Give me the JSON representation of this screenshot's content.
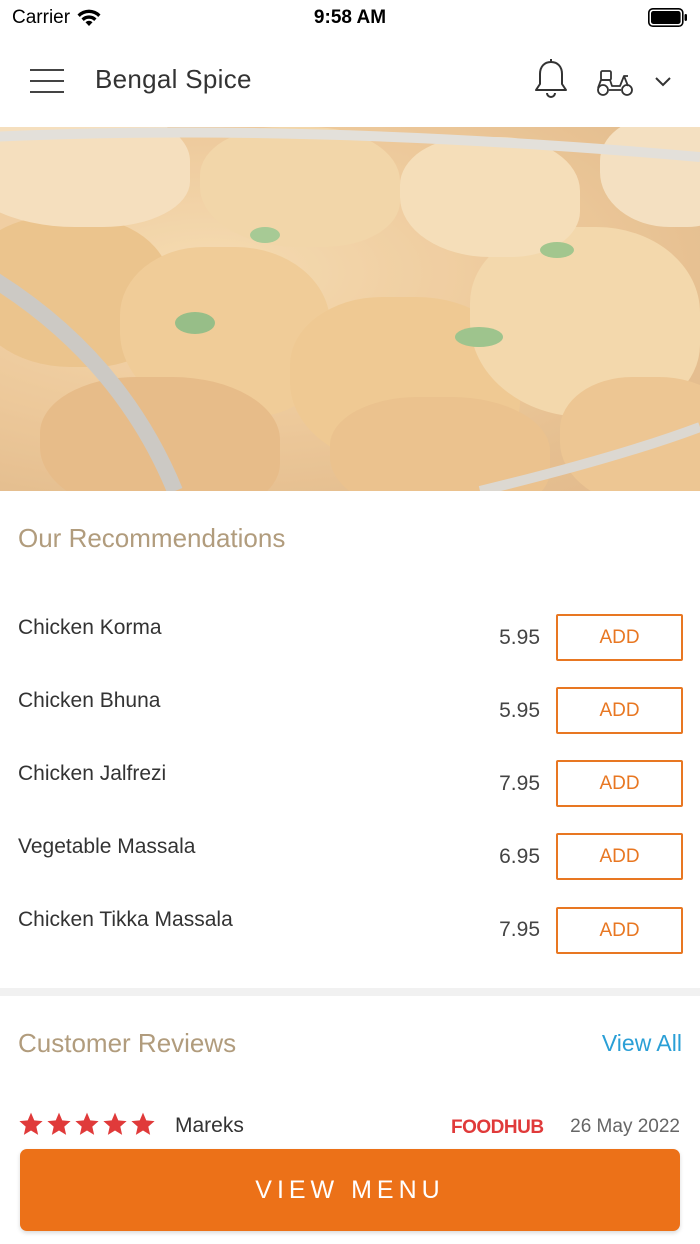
{
  "status_bar": {
    "carrier": "Carrier",
    "time": "9:58 AM"
  },
  "header": {
    "restaurant_name": "Bengal Spice",
    "menu_icon": "hamburger-menu-icon",
    "notification_icon": "bell-icon",
    "order_mode_icon": "scooter-delivery-icon",
    "dropdown_icon": "chevron-down-icon"
  },
  "hero": {
    "image_subject": "chicken curry dish"
  },
  "recommendations": {
    "title": "Our Recommendations",
    "items": [
      {
        "name": "Chicken Korma",
        "price": "5.95",
        "button": "ADD"
      },
      {
        "name": "Chicken Bhuna",
        "price": "5.95",
        "button": "ADD"
      },
      {
        "name": "Chicken Jalfrezi",
        "price": "7.95",
        "button": "ADD"
      },
      {
        "name": "Vegetable Massala",
        "price": "6.95",
        "button": "ADD"
      },
      {
        "name": "Chicken Tikka Massala",
        "price": "7.95",
        "button": "ADD"
      }
    ]
  },
  "reviews": {
    "title": "Customer Reviews",
    "view_all": "View All",
    "items": [
      {
        "rating": 5,
        "reviewer": "Mareks",
        "source": "FOODHUB",
        "date": "26 May 2022"
      }
    ]
  },
  "cta": {
    "label": "VIEW MENU"
  },
  "colors": {
    "accent": "#ec7118",
    "section_title": "#b19c7d",
    "link": "#2a9fd6",
    "star": "#e03a3a"
  }
}
